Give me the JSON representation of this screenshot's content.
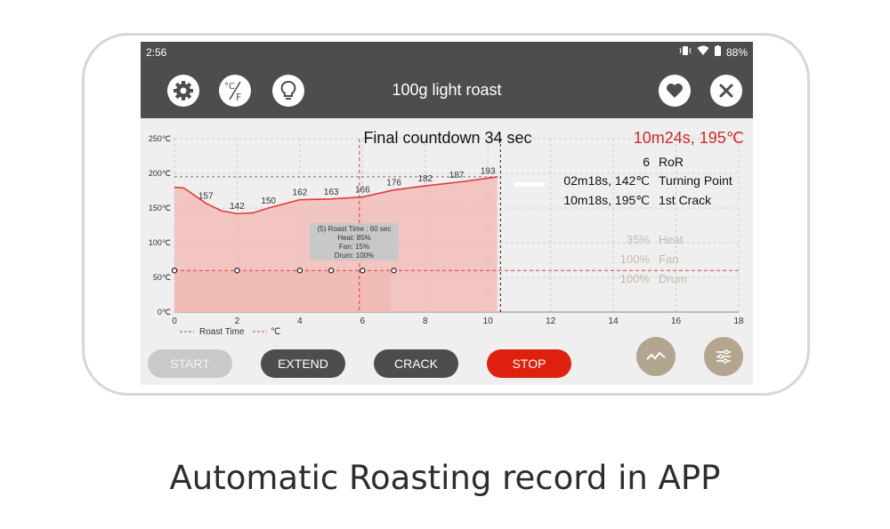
{
  "status_bar": {
    "time": "2:56",
    "battery": "88%"
  },
  "app_bar": {
    "title": "100g light roast",
    "temp_unit_glyph": "°C/F"
  },
  "icons": [
    "settings-gear-icon",
    "temperature-unit-icon",
    "lightbulb-icon",
    "heart-icon",
    "close-icon",
    "vibrate-icon",
    "wifi-icon",
    "battery-icon",
    "chart-line-icon",
    "sliders-icon"
  ],
  "info": {
    "countdown": "Final countdown 34 sec",
    "elapsed": "10m24s, 195℃",
    "ror_value": "6",
    "ror_label": "RoR",
    "turning_point_value": "02m18s, 142℃",
    "turning_point_label": "Turning Point",
    "first_crack_value": "10m18s, 195℃",
    "first_crack_label": "1st Crack",
    "heat_value": "35%",
    "heat_label": "Heat",
    "fan_value": "100%",
    "fan_label": "Fan",
    "drum_value": "100%",
    "drum_label": "Drum"
  },
  "tooltip": {
    "line1": "(5) Roast Time : 60 sec",
    "line2": "Heat: 85%",
    "line3": "Fan: 15%",
    "line4": "Drum: 100%"
  },
  "buttons": {
    "start": "START",
    "extend": "EXTEND",
    "crack": "CRACK",
    "stop": "STOP"
  },
  "colors": {
    "bar": "#4d4d4d",
    "curve": "#e23b3b",
    "stop": "#e0200e",
    "fab": "#b3a58e",
    "disabled": "#c9c9c9",
    "dark_button": "#4d4d4d"
  },
  "chart_data": {
    "type": "line",
    "x": [
      0,
      0.3,
      1,
      1.5,
      2,
      2.5,
      3,
      3.5,
      4,
      5,
      6,
      7,
      8,
      9,
      10,
      10.3
    ],
    "y": [
      180,
      179,
      157,
      146,
      142,
      143,
      150,
      156,
      162,
      163,
      166,
      176,
      182,
      187,
      193,
      195
    ],
    "point_labels": [
      {
        "x": 1,
        "y": 157,
        "label": "157"
      },
      {
        "x": 2,
        "y": 142,
        "label": "142"
      },
      {
        "x": 3,
        "y": 150,
        "label": "150"
      },
      {
        "x": 4,
        "y": 162,
        "label": "162"
      },
      {
        "x": 5,
        "y": 163,
        "label": "163"
      },
      {
        "x": 6,
        "y": 166,
        "label": "166"
      },
      {
        "x": 7,
        "y": 176,
        "label": "176"
      },
      {
        "x": 8,
        "y": 182,
        "label": "182"
      },
      {
        "x": 9,
        "y": 187,
        "label": "187"
      },
      {
        "x": 10,
        "y": 193,
        "label": "193"
      }
    ],
    "x_ticks": [
      "0",
      "2",
      "4",
      "6",
      "8",
      "10",
      "12",
      "14",
      "16",
      "18"
    ],
    "y_ticks": [
      "0℃",
      "50℃",
      "100℃",
      "150℃",
      "200℃",
      "250℃"
    ],
    "xlim": [
      0,
      18
    ],
    "ylim": [
      0,
      250
    ],
    "markers_x": [
      0,
      2,
      4,
      5,
      6,
      7
    ],
    "marker_level": 60,
    "shaded_until_x": 6.9,
    "current_x": 10.4,
    "first_crack_x": 10.3,
    "cursor_x": 5.9,
    "legend": [
      "Roast Time",
      "℃"
    ],
    "grid": true
  },
  "caption": "Automatic Roasting record in APP"
}
